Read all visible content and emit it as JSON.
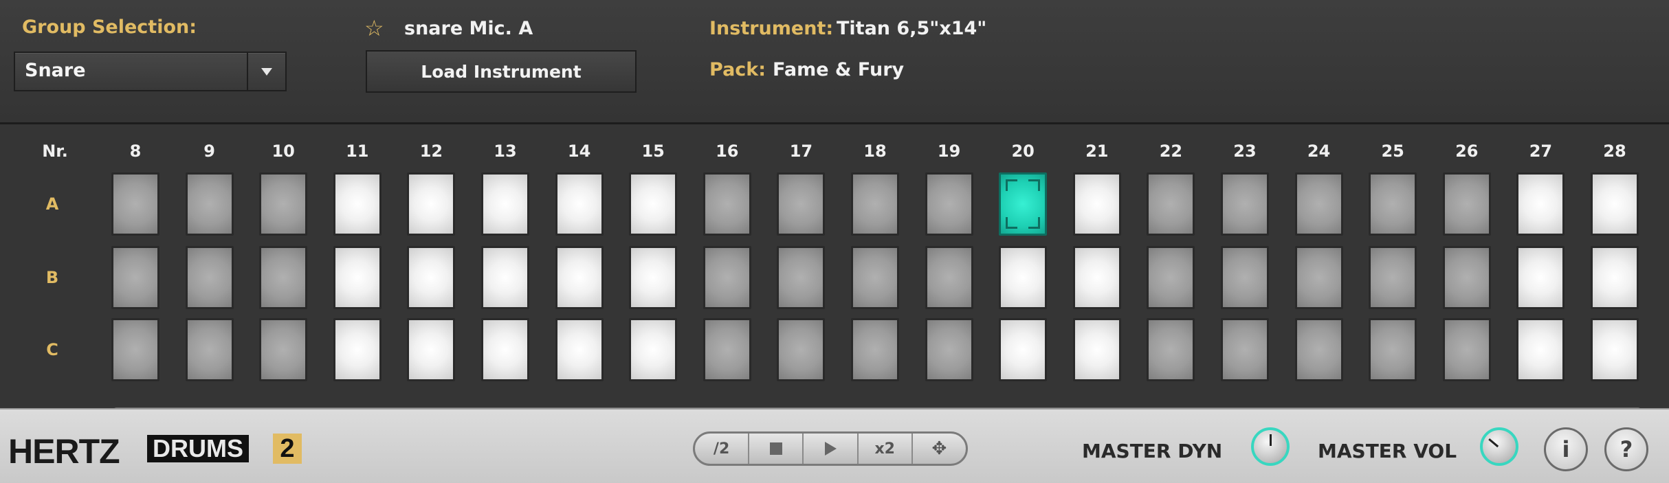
{
  "header": {
    "group_label": "Group Selection:",
    "group_value": "Snare",
    "mic_name": "snare Mic. A",
    "load_button": "Load Instrument",
    "instrument_label": "Instrument:",
    "instrument_value": "Titan 6,5\"x14\"",
    "pack_label": "Pack:",
    "pack_value": "Fame & Fury"
  },
  "grid": {
    "nr_label": "Nr.",
    "columns": [
      "8",
      "9",
      "10",
      "11",
      "12",
      "13",
      "14",
      "15",
      "16",
      "17",
      "18",
      "19",
      "20",
      "21",
      "22",
      "23",
      "24",
      "25",
      "26",
      "27",
      "28"
    ],
    "rows": [
      {
        "label": "A",
        "states": [
          "dark",
          "dark",
          "dark",
          "light",
          "light",
          "light",
          "light",
          "light",
          "dark",
          "dark",
          "dark",
          "dark",
          "selected",
          "light",
          "dark",
          "dark",
          "dark",
          "dark",
          "dark",
          "light",
          "light"
        ]
      },
      {
        "label": "B",
        "states": [
          "dark",
          "dark",
          "dark",
          "light",
          "light",
          "light",
          "light",
          "light",
          "dark",
          "dark",
          "dark",
          "dark",
          "light",
          "light",
          "dark",
          "dark",
          "dark",
          "dark",
          "dark",
          "light",
          "light"
        ]
      },
      {
        "label": "C",
        "states": [
          "dark",
          "dark",
          "dark",
          "light",
          "light",
          "light",
          "light",
          "light",
          "dark",
          "dark",
          "dark",
          "dark",
          "light",
          "light",
          "dark",
          "dark",
          "dark",
          "dark",
          "dark",
          "light",
          "light"
        ]
      }
    ],
    "selected_color": "#1ed0b4"
  },
  "footer": {
    "logo_hertz": "HERTZ",
    "logo_drums": "DRUMS",
    "logo_version": "2",
    "transport": {
      "half": "/2",
      "stop": "stop-icon",
      "play": "play-icon",
      "double": "x2",
      "move": "move-icon"
    },
    "master_dyn_label": "MASTER DYN",
    "master_vol_label": "MASTER VOL",
    "info": "i",
    "help": "?"
  },
  "colors": {
    "accent_gold": "#e1bb63",
    "accent_teal": "#38d7c0"
  }
}
